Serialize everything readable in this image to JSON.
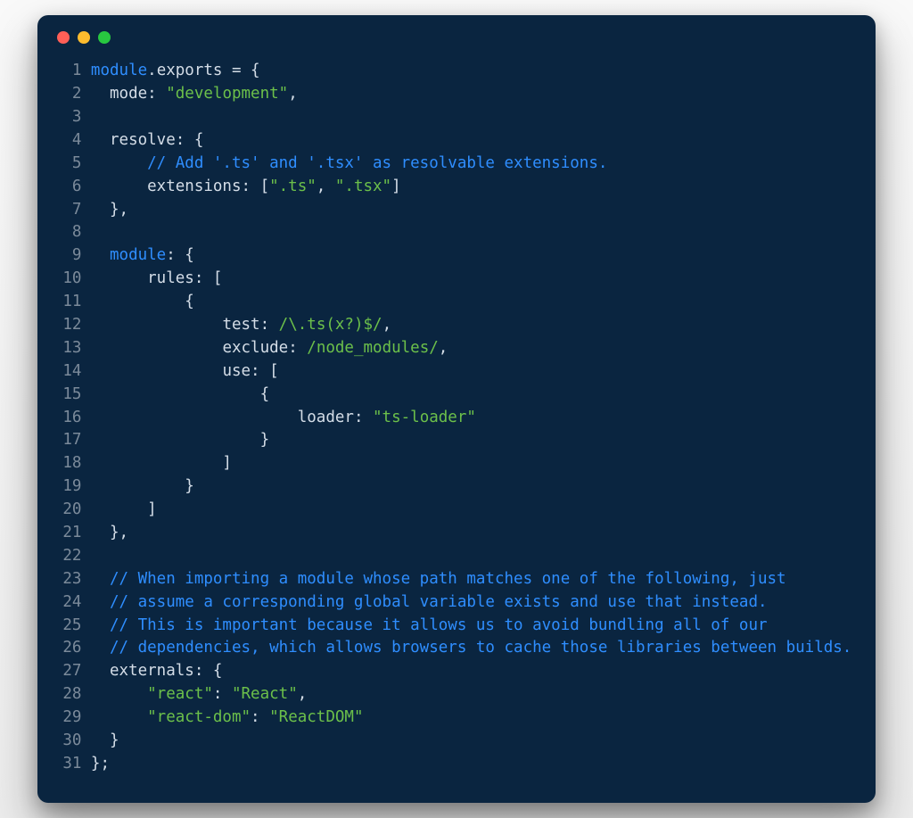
{
  "window": {
    "dots": [
      "close",
      "minimize",
      "zoom"
    ]
  },
  "lines": [
    {
      "n": "1",
      "tokens": [
        [
          "kw",
          "module"
        ],
        [
          "punct",
          "."
        ],
        [
          "prop",
          "exports"
        ],
        [
          "punct",
          " = {"
        ]
      ]
    },
    {
      "n": "2",
      "tokens": [
        [
          "punct",
          "  "
        ],
        [
          "prop",
          "mode"
        ],
        [
          "punct",
          ": "
        ],
        [
          "str",
          "\"development\""
        ],
        [
          "punct",
          ","
        ]
      ]
    },
    {
      "n": "3",
      "tokens": [
        [
          "punct",
          ""
        ]
      ]
    },
    {
      "n": "4",
      "tokens": [
        [
          "punct",
          "  "
        ],
        [
          "prop",
          "resolve"
        ],
        [
          "punct",
          ": {"
        ]
      ]
    },
    {
      "n": "5",
      "tokens": [
        [
          "punct",
          "      "
        ],
        [
          "cmt",
          "// Add '.ts' and '.tsx' as resolvable extensions."
        ]
      ]
    },
    {
      "n": "6",
      "tokens": [
        [
          "punct",
          "      "
        ],
        [
          "prop",
          "extensions"
        ],
        [
          "punct",
          ": ["
        ],
        [
          "str",
          "\".ts\""
        ],
        [
          "punct",
          ", "
        ],
        [
          "str",
          "\".tsx\""
        ],
        [
          "punct",
          "]"
        ]
      ]
    },
    {
      "n": "7",
      "tokens": [
        [
          "punct",
          "  },"
        ]
      ]
    },
    {
      "n": "8",
      "tokens": [
        [
          "punct",
          ""
        ]
      ]
    },
    {
      "n": "9",
      "tokens": [
        [
          "punct",
          "  "
        ],
        [
          "kw",
          "module"
        ],
        [
          "punct",
          ": {"
        ]
      ]
    },
    {
      "n": "10",
      "tokens": [
        [
          "punct",
          "      "
        ],
        [
          "prop",
          "rules"
        ],
        [
          "punct",
          ": ["
        ]
      ]
    },
    {
      "n": "11",
      "tokens": [
        [
          "punct",
          "          {"
        ]
      ]
    },
    {
      "n": "12",
      "tokens": [
        [
          "punct",
          "              "
        ],
        [
          "prop",
          "test"
        ],
        [
          "punct",
          ": "
        ],
        [
          "regex",
          "/\\.ts(x?)$/"
        ],
        [
          "punct",
          ","
        ]
      ]
    },
    {
      "n": "13",
      "tokens": [
        [
          "punct",
          "              "
        ],
        [
          "prop",
          "exclude"
        ],
        [
          "punct",
          ": "
        ],
        [
          "regex",
          "/node_modules/"
        ],
        [
          "punct",
          ","
        ]
      ]
    },
    {
      "n": "14",
      "tokens": [
        [
          "punct",
          "              "
        ],
        [
          "prop",
          "use"
        ],
        [
          "punct",
          ": ["
        ]
      ]
    },
    {
      "n": "15",
      "tokens": [
        [
          "punct",
          "                  {"
        ]
      ]
    },
    {
      "n": "16",
      "tokens": [
        [
          "punct",
          "                      "
        ],
        [
          "prop",
          "loader"
        ],
        [
          "punct",
          ": "
        ],
        [
          "str",
          "\"ts-loader\""
        ]
      ]
    },
    {
      "n": "17",
      "tokens": [
        [
          "punct",
          "                  }"
        ]
      ]
    },
    {
      "n": "18",
      "tokens": [
        [
          "punct",
          "              ]"
        ]
      ]
    },
    {
      "n": "19",
      "tokens": [
        [
          "punct",
          "          }"
        ]
      ]
    },
    {
      "n": "20",
      "tokens": [
        [
          "punct",
          "      ]"
        ]
      ]
    },
    {
      "n": "21",
      "tokens": [
        [
          "punct",
          "  },"
        ]
      ]
    },
    {
      "n": "22",
      "tokens": [
        [
          "punct",
          ""
        ]
      ]
    },
    {
      "n": "23",
      "tokens": [
        [
          "punct",
          "  "
        ],
        [
          "cmt",
          "// When importing a module whose path matches one of the following, just"
        ]
      ]
    },
    {
      "n": "24",
      "tokens": [
        [
          "punct",
          "  "
        ],
        [
          "cmt",
          "// assume a corresponding global variable exists and use that instead."
        ]
      ]
    },
    {
      "n": "25",
      "tokens": [
        [
          "punct",
          "  "
        ],
        [
          "cmt",
          "// This is important because it allows us to avoid bundling all of our"
        ]
      ]
    },
    {
      "n": "26",
      "tokens": [
        [
          "punct",
          "  "
        ],
        [
          "cmt",
          "// dependencies, which allows browsers to cache those libraries between builds."
        ]
      ]
    },
    {
      "n": "27",
      "tokens": [
        [
          "punct",
          "  "
        ],
        [
          "prop",
          "externals"
        ],
        [
          "punct",
          ": {"
        ]
      ]
    },
    {
      "n": "28",
      "tokens": [
        [
          "punct",
          "      "
        ],
        [
          "str",
          "\"react\""
        ],
        [
          "punct",
          ": "
        ],
        [
          "str",
          "\"React\""
        ],
        [
          "punct",
          ","
        ]
      ]
    },
    {
      "n": "29",
      "tokens": [
        [
          "punct",
          "      "
        ],
        [
          "str",
          "\"react-dom\""
        ],
        [
          "punct",
          ": "
        ],
        [
          "str",
          "\"ReactDOM\""
        ]
      ]
    },
    {
      "n": "30",
      "tokens": [
        [
          "punct",
          "  }"
        ]
      ]
    },
    {
      "n": "31",
      "tokens": [
        [
          "punct",
          "};"
        ]
      ]
    }
  ]
}
